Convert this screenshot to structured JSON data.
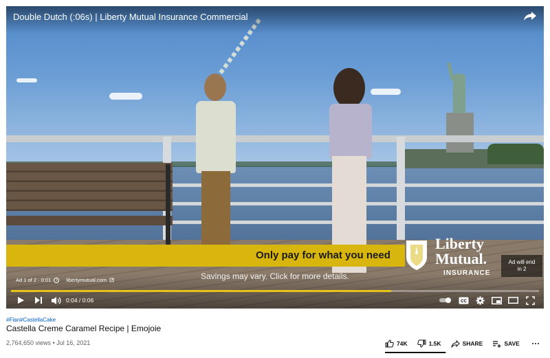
{
  "player": {
    "video_title": "Double Dutch (:06s) | Liberty Mutual Insurance Commercial",
    "ad": {
      "tagline": "Only pay for what you need",
      "disclaimer": "Savings may vary. Click for more details.",
      "brand_line1": "Liberty",
      "brand_line2": "Mutual.",
      "brand_line3": "INSURANCE",
      "ad_end_line1": "Ad will end",
      "ad_end_line2": "in 2",
      "ad_counter": "Ad 1 of 2 · 0:01",
      "advertiser_url": "libertymutual.com",
      "banner_color": "#d8b60e"
    },
    "controls": {
      "time_display": "0:04 / 0:06",
      "progress_fraction": 0.72,
      "progress_color": "#e7c31a",
      "icons": [
        "play-icon",
        "next-icon",
        "volume-icon",
        "autoplay-toggle-icon",
        "captions-icon",
        "settings-icon",
        "miniplayer-icon",
        "theater-icon",
        "fullscreen-icon",
        "share-icon"
      ]
    }
  },
  "video_info": {
    "hashtag1": "#Flan",
    "hashtag2": "#CastellaCake",
    "title": "Castella Creme Caramel Recipe | Emojoie",
    "views": "2,764,650 views",
    "separator": "•",
    "date": "Jul 16, 2021"
  },
  "actions": {
    "like_count": "74K",
    "dislike_count": "1.5K",
    "share_label": "SHARE",
    "save_label": "SAVE",
    "like_ratio": 0.98
  }
}
